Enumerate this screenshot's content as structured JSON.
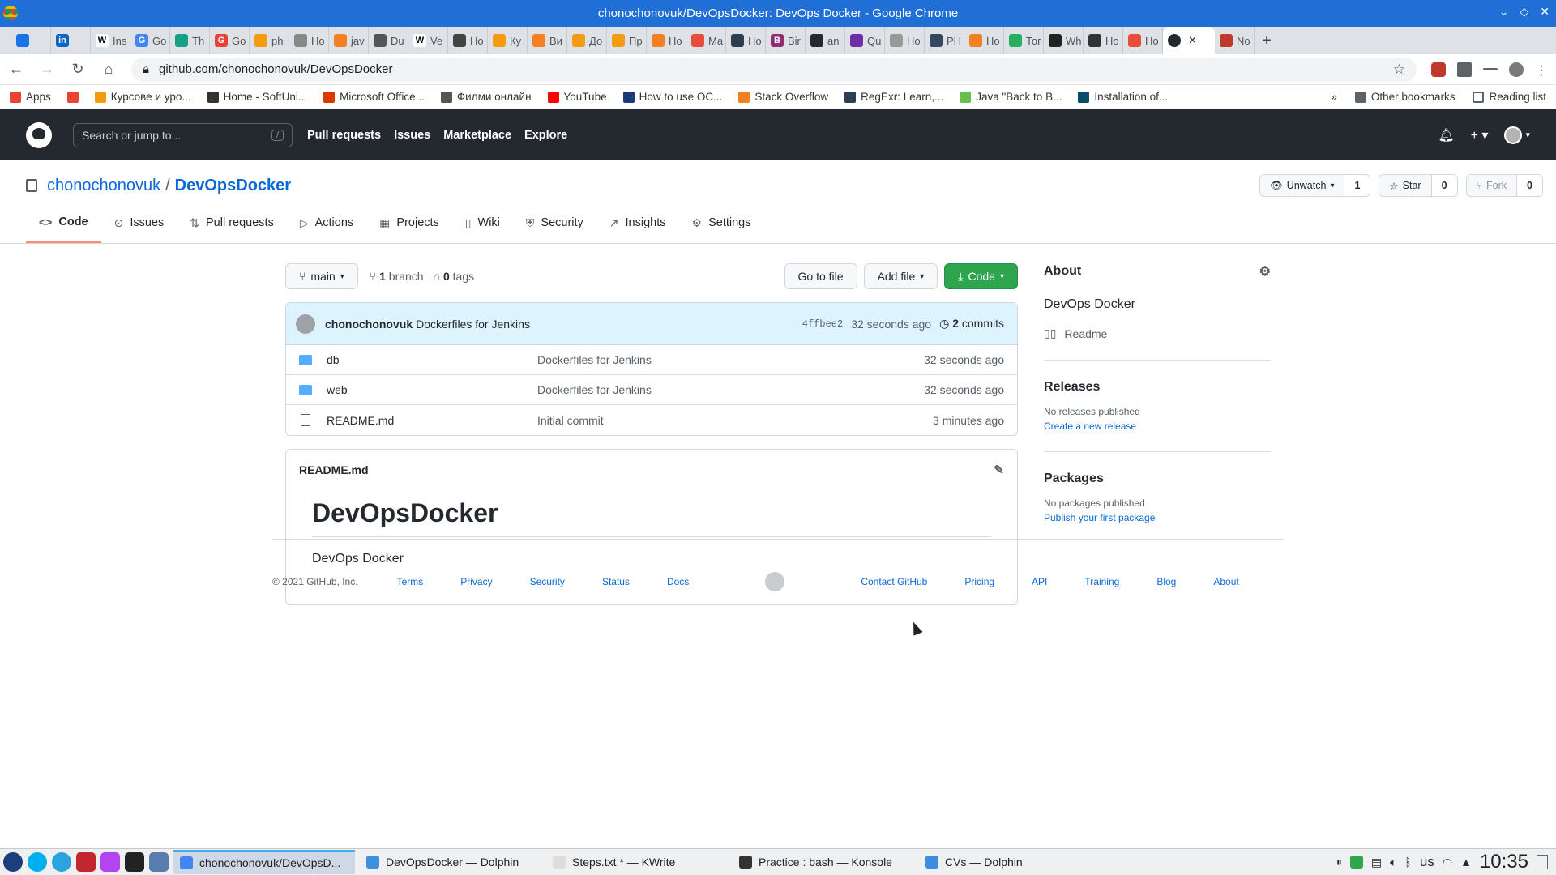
{
  "window": {
    "title": "chonochonovuk/DevOpsDocker: DevOps Docker - Google Chrome"
  },
  "tabs": [
    {
      "label": "",
      "color": "#1a73e8",
      "glyph": ""
    },
    {
      "label": "",
      "color": "#0a66c2",
      "glyph": "in"
    },
    {
      "label": "Ins",
      "color": "#ffffff",
      "glyph": "W"
    },
    {
      "label": "Go",
      "color": "#4285f4",
      "glyph": "G"
    },
    {
      "label": "Th",
      "color": "#16a085",
      "glyph": ""
    },
    {
      "label": "Go",
      "color": "#ea4335",
      "glyph": "G"
    },
    {
      "label": "ph",
      "color": "#f39c12",
      "glyph": ""
    },
    {
      "label": "Ho",
      "color": "#888888",
      "glyph": ""
    },
    {
      "label": "jav",
      "color": "#f48024",
      "glyph": ""
    },
    {
      "label": "Du",
      "color": "#555555",
      "glyph": ""
    },
    {
      "label": "Ve",
      "color": "#ffffff",
      "glyph": "W"
    },
    {
      "label": "Ho",
      "color": "#444444",
      "glyph": ""
    },
    {
      "label": "Ку",
      "color": "#f39c12",
      "glyph": ""
    },
    {
      "label": "Ви",
      "color": "#f48024",
      "glyph": ""
    },
    {
      "label": "До",
      "color": "#f39c12",
      "glyph": ""
    },
    {
      "label": "Пр",
      "color": "#f39c12",
      "glyph": ""
    },
    {
      "label": "Ho",
      "color": "#f48024",
      "glyph": ""
    },
    {
      "label": "Ma",
      "color": "#e74c3c",
      "glyph": ""
    },
    {
      "label": "Ho",
      "color": "#2c3e50",
      "glyph": ""
    },
    {
      "label": "Bir",
      "color": "#8e2d73",
      "glyph": "B"
    },
    {
      "label": "an",
      "color": "#24292f",
      "glyph": ""
    },
    {
      "label": "Qu",
      "color": "#6f2da8",
      "glyph": ""
    },
    {
      "label": "Ho",
      "color": "#999999",
      "glyph": ""
    },
    {
      "label": "PH",
      "color": "#34495e",
      "glyph": ""
    },
    {
      "label": "Ho",
      "color": "#f48024",
      "glyph": ""
    },
    {
      "label": "Тог",
      "color": "#27ae60",
      "glyph": ""
    },
    {
      "label": "Wh",
      "color": "#222222",
      "glyph": ""
    },
    {
      "label": "Ho",
      "color": "#333333",
      "glyph": ""
    },
    {
      "label": "Ho",
      "color": "#e74c3c",
      "glyph": ""
    }
  ],
  "active_tab": {
    "close": "✕"
  },
  "extra_tab": {
    "label": "No"
  },
  "address": {
    "url": "github.com/chonochonovuk/DevOpsDocker"
  },
  "bookmarks": [
    {
      "label": "Apps",
      "color": "#ea4335"
    },
    {
      "label": "",
      "color": "#ea4335"
    },
    {
      "label": "Курсове и уро...",
      "color": "#f39c12"
    },
    {
      "label": "Home - SoftUni...",
      "color": "#333333"
    },
    {
      "label": "Microsoft Office...",
      "color": "#d83b01"
    },
    {
      "label": "Филми онлайн",
      "color": "#555555"
    },
    {
      "label": "YouTube",
      "color": "#ff0000"
    },
    {
      "label": "How to use OC...",
      "color": "#1a3a7a"
    },
    {
      "label": "Stack Overflow",
      "color": "#f48024"
    },
    {
      "label": "RegExr: Learn,...",
      "color": "#2c3e50"
    },
    {
      "label": "Java \"Back to B...",
      "color": "#6abf4b"
    },
    {
      "label": "Installation of...",
      "color": "#0a4c6a"
    }
  ],
  "bookmarks_right": {
    "more": "»",
    "other": "Other bookmarks",
    "reading": "Reading list"
  },
  "gh": {
    "search_placeholder": "Search or jump to...",
    "search_key": "/",
    "nav": [
      "Pull requests",
      "Issues",
      "Marketplace",
      "Explore"
    ]
  },
  "repo": {
    "owner": "chonochonovuk",
    "sep": "/",
    "name": "DevOpsDocker",
    "watch_label": "Unwatch",
    "watch_count": "1",
    "star_label": "Star",
    "star_count": "0",
    "fork_label": "Fork",
    "fork_count": "0"
  },
  "repo_tabs": [
    {
      "label": "Code",
      "icon": "<>"
    },
    {
      "label": "Issues",
      "icon": "⊙"
    },
    {
      "label": "Pull requests",
      "icon": "⇅"
    },
    {
      "label": "Actions",
      "icon": "▷"
    },
    {
      "label": "Projects",
      "icon": "▦"
    },
    {
      "label": "Wiki",
      "icon": "▯"
    },
    {
      "label": "Security",
      "icon": "⛨"
    },
    {
      "label": "Insights",
      "icon": "↗"
    },
    {
      "label": "Settings",
      "icon": "⚙"
    }
  ],
  "filenav": {
    "branch": "main",
    "branch_count": "1",
    "branch_word": "branch",
    "tag_count": "0",
    "tag_word": "tags",
    "go_to_file": "Go to file",
    "add_file": "Add file",
    "code": "Code"
  },
  "commit": {
    "author": "chonochonovuk",
    "message": "Dockerfiles for Jenkins",
    "sha": "4ffbee2",
    "time": "32 seconds ago",
    "count": "2",
    "count_word": "commits"
  },
  "files": [
    {
      "name": "db",
      "type": "folder",
      "message": "Dockerfiles for Jenkins",
      "age": "32 seconds ago"
    },
    {
      "name": "web",
      "type": "folder",
      "message": "Dockerfiles for Jenkins",
      "age": "32 seconds ago"
    },
    {
      "name": "README.md",
      "type": "file",
      "message": "Initial commit",
      "age": "3 minutes ago"
    }
  ],
  "readme": {
    "filename": "README.md",
    "heading": "DevOpsDocker",
    "body": "DevOps Docker"
  },
  "about": {
    "title": "About",
    "description": "DevOps Docker",
    "readme_link": "Readme",
    "releases_title": "Releases",
    "releases_none": "No releases published",
    "releases_link": "Create a new release",
    "packages_title": "Packages",
    "packages_none": "No packages published",
    "packages_link": "Publish your first package"
  },
  "footer": {
    "copyright": "© 2021 GitHub, Inc.",
    "left_links": [
      "Terms",
      "Privacy",
      "Security",
      "Status",
      "Docs"
    ],
    "right_links": [
      "Contact GitHub",
      "Pricing",
      "API",
      "Training",
      "Blog",
      "About"
    ]
  },
  "taskbar": {
    "windows": [
      {
        "label": "chonochonovuk/DevOpsD...",
        "color": "#4285f4",
        "active": true
      },
      {
        "label": "DevOpsDocker — Dolphin",
        "color": "#3d8ee0",
        "active": false
      },
      {
        "label": "Steps.txt * — KWrite",
        "color": "#dddddd",
        "active": false
      },
      {
        "label": "Practice : bash — Konsole",
        "color": "#333333",
        "active": false
      },
      {
        "label": "CVs — Dolphin",
        "color": "#3d8ee0",
        "active": false
      }
    ],
    "keyboard": "us",
    "clock": "10:35"
  },
  "colors": {
    "accent": "#0969da",
    "green": "#2da44e",
    "header": "#24292f",
    "chrome": "#1f6fd6"
  }
}
